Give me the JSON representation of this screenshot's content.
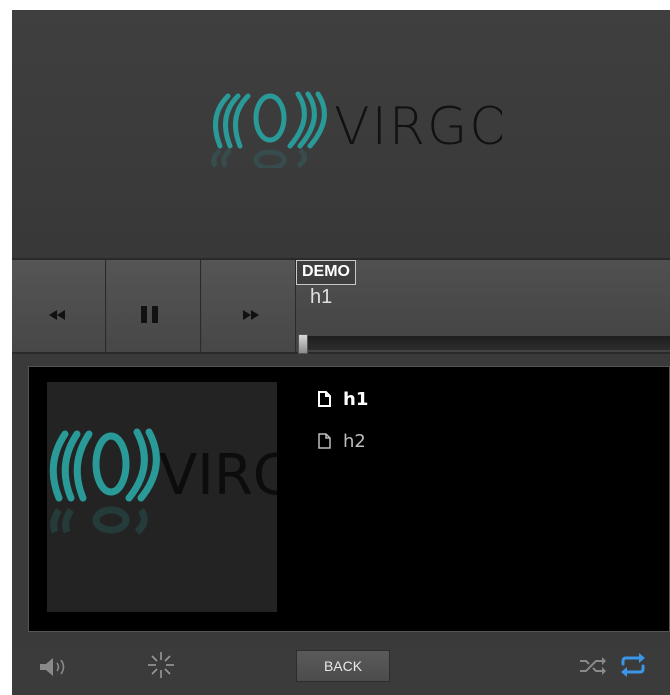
{
  "banner": {
    "logo_text": "VIRGO",
    "logo_icon": "virgo-waves-logo",
    "logo_color": "#2a9a98"
  },
  "controls": {
    "rewind_icon": "rewind-icon",
    "pause_icon": "pause-icon",
    "forward_icon": "fast-forward-icon",
    "tooltip": "DEMO",
    "track_title": "h1",
    "progress": 0.0
  },
  "playlist": {
    "items": [
      {
        "label": "h1",
        "icon": "file-icon",
        "active": true
      },
      {
        "label": "h2",
        "icon": "file-icon",
        "active": false
      }
    ]
  },
  "album_art": {
    "logo_text": "VIRGO"
  },
  "bottom_bar": {
    "volume_icon": "volume-icon",
    "visualizer_icon": "visualizer-burst-icon",
    "back_label": "BACK",
    "shuffle_icon": "shuffle-icon",
    "repeat_icon": "repeat-icon",
    "repeat_color": "#3b95e8"
  }
}
